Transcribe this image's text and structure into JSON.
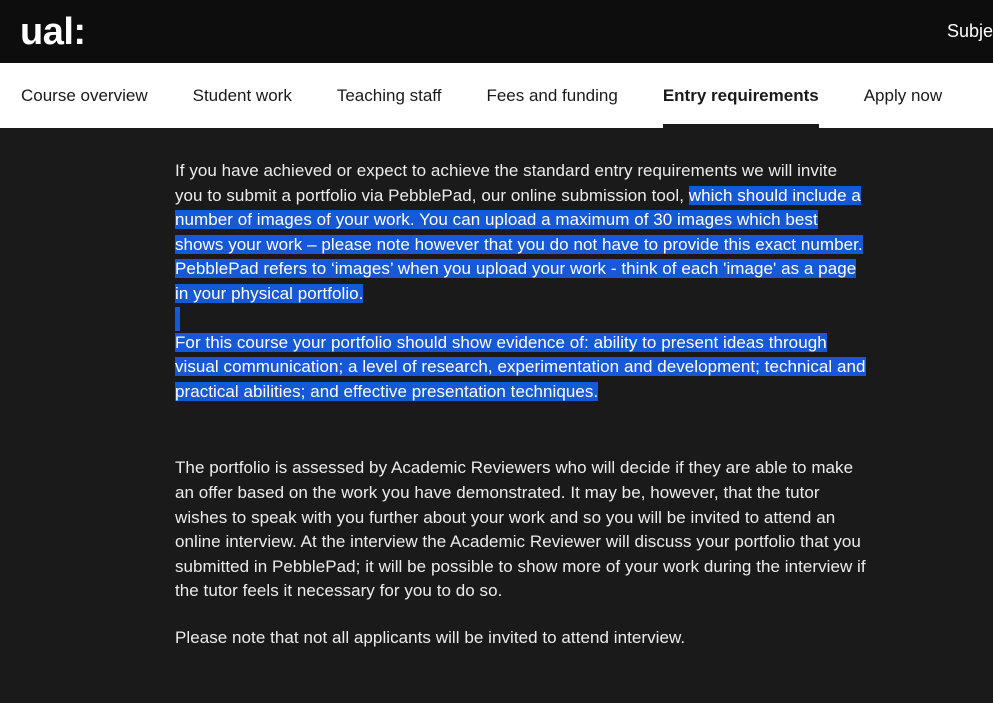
{
  "header": {
    "logo": "ual:",
    "right_link": "Subject"
  },
  "nav": {
    "items": [
      {
        "label": "Course overview",
        "active": false
      },
      {
        "label": "Student work",
        "active": false
      },
      {
        "label": "Teaching staff",
        "active": false
      },
      {
        "label": "Fees and funding",
        "active": false
      },
      {
        "label": "Entry requirements",
        "active": true
      },
      {
        "label": "Apply now",
        "active": false
      }
    ]
  },
  "content": {
    "paragraph1": {
      "plain_lead": "If you have achieved or expect to achieve the standard entry requirements we will invite you to submit a portfolio via PebblePad, our online submission tool, ",
      "selected_tail": "which should include a number of images of your work. You can upload a maximum of 30 images which best shows your work – please note however that you do not have to provide this exact number. PebblePad refers to ‘images’ when you upload your work - think of each 'image' as a page in your physical portfolio."
    },
    "paragraph2": {
      "selected": "For this course your portfolio should show evidence of: ability to present ideas through visual communication; a level of research, experimentation and development; technical and practical abilities; and effective presentation techniques."
    },
    "paragraph3": "The portfolio is assessed by Academic Reviewers who will decide if they are able to make an offer based on the work you have demonstrated. It may be, however, that the tutor wishes to speak with you further about your work and so you will be invited to attend an online interview. At the interview the Academic Reviewer will discuss your portfolio that you submitted in PebblePad; it will be possible to show more of your work during the interview if the tutor feels it necessary for you to do so.",
    "paragraph4": "Please note that not all applicants will be invited to attend interview."
  },
  "colors": {
    "page_background": "#1a1a1a",
    "header_background": "#0d0d0d",
    "nav_background": "#ffffff",
    "selection_blue": "#1559d6",
    "body_text": "#ececec"
  }
}
